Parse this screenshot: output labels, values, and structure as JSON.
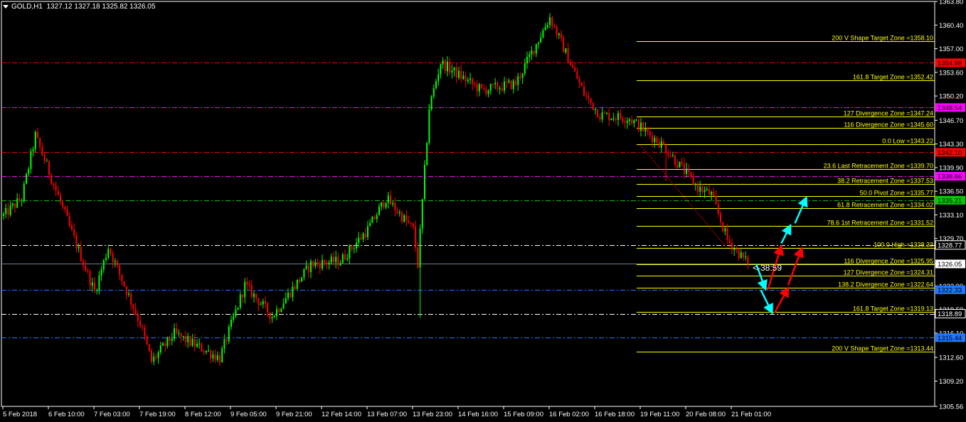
{
  "header": {
    "symbol": "GOLD,H1",
    "ohlc": "1327.12 1327.18 1325.82 1326.05"
  },
  "timer_text": "<-38:59",
  "colors": {
    "background": "#000000",
    "bull": "#00ff00",
    "bear": "#ff0000",
    "fib": "#ffff00",
    "axis": "#ffffff"
  },
  "chart_data": {
    "type": "candlestick",
    "y_ticks": [
      "1363.80",
      "1360.40",
      "1357.00",
      "1353.60",
      "1350.20",
      "1346.70",
      "1343.30",
      "1339.90",
      "1336.50",
      "1333.10",
      "1329.70",
      "1326.05",
      "1322.90",
      "1319.50",
      "1316.10",
      "1312.60",
      "1309.20",
      "1305.56"
    ],
    "x_ticks": [
      "5 Feb 2018",
      "6 Feb 10:00",
      "7 Feb 03:00",
      "7 Feb 19:00",
      "8 Feb 12:00",
      "9 Feb 05:00",
      "9 Feb 21:00",
      "12 Feb 14:00",
      "13 Feb 07:00",
      "13 Feb 23:00",
      "14 Feb 16:00",
      "15 Feb 09:00",
      "16 Feb 02:00",
      "16 Feb 18:00",
      "19 Feb 11:00",
      "20 Feb 08:00",
      "21 Feb 01:00"
    ],
    "y_range": [
      1305.56,
      1363.8
    ],
    "current_price": 1326.05,
    "key_points": [
      {
        "t": 0,
        "p": 1333.0
      },
      {
        "t": 8,
        "p": 1335.5
      },
      {
        "t": 14,
        "p": 1344.5
      },
      {
        "t": 30,
        "p": 1330.5
      },
      {
        "t": 40,
        "p": 1322.0
      },
      {
        "t": 46,
        "p": 1328.5
      },
      {
        "t": 60,
        "p": 1317.5
      },
      {
        "t": 65,
        "p": 1312.0
      },
      {
        "t": 75,
        "p": 1316.0
      },
      {
        "t": 95,
        "p": 1312.5
      },
      {
        "t": 106,
        "p": 1323.0
      },
      {
        "t": 118,
        "p": 1318.5
      },
      {
        "t": 135,
        "p": 1326.0
      },
      {
        "t": 148,
        "p": 1326.5
      },
      {
        "t": 160,
        "p": 1331.0
      },
      {
        "t": 168,
        "p": 1335.5
      },
      {
        "t": 180,
        "p": 1331.0
      },
      {
        "t": 182,
        "p": 1326.0
      },
      {
        "t": 187,
        "p": 1348.5
      },
      {
        "t": 192,
        "p": 1355.0
      },
      {
        "t": 210,
        "p": 1351.0
      },
      {
        "t": 225,
        "p": 1352.0
      },
      {
        "t": 240,
        "p": 1361.5
      },
      {
        "t": 255,
        "p": 1350.5
      },
      {
        "t": 262,
        "p": 1347.5
      },
      {
        "t": 275,
        "p": 1347.0
      },
      {
        "t": 290,
        "p": 1343.0
      },
      {
        "t": 305,
        "p": 1337.0
      },
      {
        "t": 311,
        "p": 1336.0
      },
      {
        "t": 318,
        "p": 1329.5
      },
      {
        "t": 327,
        "p": 1326.05
      }
    ],
    "spikes": [
      {
        "t": 183,
        "high": 1326.5,
        "low": 1318.3
      },
      {
        "t": 291,
        "high": 1343.4,
        "low": 1338.0
      }
    ],
    "h_lines": [
      {
        "value": 1354.98,
        "label": "1354.98",
        "color": "#ff0000",
        "style": "dashdot"
      },
      {
        "value": 1348.54,
        "label": "1348.54",
        "color": "#ff00ff",
        "style": "dashdot"
      },
      {
        "value": 1342.1,
        "label": "1342.10",
        "color": "#ff0000",
        "style": "dashdot"
      },
      {
        "value": 1338.66,
        "label": "1338.66",
        "color": "#ff00ff",
        "style": "dashdot"
      },
      {
        "value": 1335.21,
        "label": "1335.21",
        "color": "#00cc00",
        "style": "dashdot"
      },
      {
        "value": 1328.77,
        "label": "1328.77",
        "color": "#ffffff",
        "style": "dashdot"
      },
      {
        "value": 1322.33,
        "label": "1322.33",
        "color": "#1e78ff",
        "style": "dashdot"
      },
      {
        "value": 1318.89,
        "label": "1318.89",
        "color": "#ffffff",
        "style": "dashdot"
      },
      {
        "value": 1315.44,
        "label": "1315.44",
        "color": "#1e78ff",
        "style": "dashdot"
      }
    ],
    "fib_levels": [
      {
        "value": 1358.1,
        "label": "200  V Shape Target Zone =1358.10"
      },
      {
        "value": 1352.42,
        "label": "161.8 Target Zone =1352.42"
      },
      {
        "value": 1347.24,
        "label": "127 Divergence Zone =1347.24"
      },
      {
        "value": 1345.6,
        "label": "116 Divergence Zone =1345.60"
      },
      {
        "value": 1343.22,
        "label": "0.0 Low =1343.22"
      },
      {
        "value": 1339.7,
        "label": "23.6 Last Retracement Zone =1339.70"
      },
      {
        "value": 1337.53,
        "label": "38.2 Retracement Zone =1337.53"
      },
      {
        "value": 1335.77,
        "label": "50.0 Pivot Zone =1335.77"
      },
      {
        "value": 1334.02,
        "label": "61.8 Retracement Zone =1334.02"
      },
      {
        "value": 1331.52,
        "label": "78.6 1st Retracement Zone =1331.52"
      },
      {
        "value": 1328.33,
        "label": "100.0 High =1328.33"
      },
      {
        "value": 1325.95,
        "label": "116 Divergence Zone =1325.95"
      },
      {
        "value": 1324.31,
        "label": "127 Divergence Zone =1324.31"
      },
      {
        "value": 1322.64,
        "label": "138.2 Divergence Zone =1322.64"
      },
      {
        "value": 1319.13,
        "label": "161.8 Target Zone =1319.13"
      },
      {
        "value": 1313.44,
        "label": "200 V Shape Target Zone =1313.44"
      }
    ],
    "projection_arrows": [
      {
        "color": "#00ffff",
        "from": {
          "t": 331,
          "p": 1326.0
        },
        "to": {
          "t": 335,
          "p": 1322.4
        }
      },
      {
        "color": "#ff0000",
        "from": {
          "t": 336,
          "p": 1322.3
        },
        "to": {
          "t": 342,
          "p": 1328.6
        }
      },
      {
        "color": "#00ffff",
        "from": {
          "t": 342,
          "p": 1329.0
        },
        "to": {
          "t": 346,
          "p": 1331.6
        }
      },
      {
        "color": "#00ffff",
        "from": {
          "t": 348,
          "p": 1331.9
        },
        "to": {
          "t": 353,
          "p": 1335.6
        }
      },
      {
        "color": "#00ffff",
        "from": {
          "t": 333,
          "p": 1322.3
        },
        "to": {
          "t": 338,
          "p": 1319.0
        }
      },
      {
        "color": "#ff0000",
        "from": {
          "t": 339,
          "p": 1319.0
        },
        "to": {
          "t": 345,
          "p": 1322.6
        }
      },
      {
        "color": "#ff0000",
        "from": {
          "t": 345,
          "p": 1323.0
        },
        "to": {
          "t": 351,
          "p": 1328.3
        }
      }
    ],
    "trend_line": {
      "color": "#ff0000",
      "from": {
        "t": 280,
        "p": 1343.2
      },
      "to": {
        "t": 318,
        "p": 1328.4
      }
    }
  }
}
